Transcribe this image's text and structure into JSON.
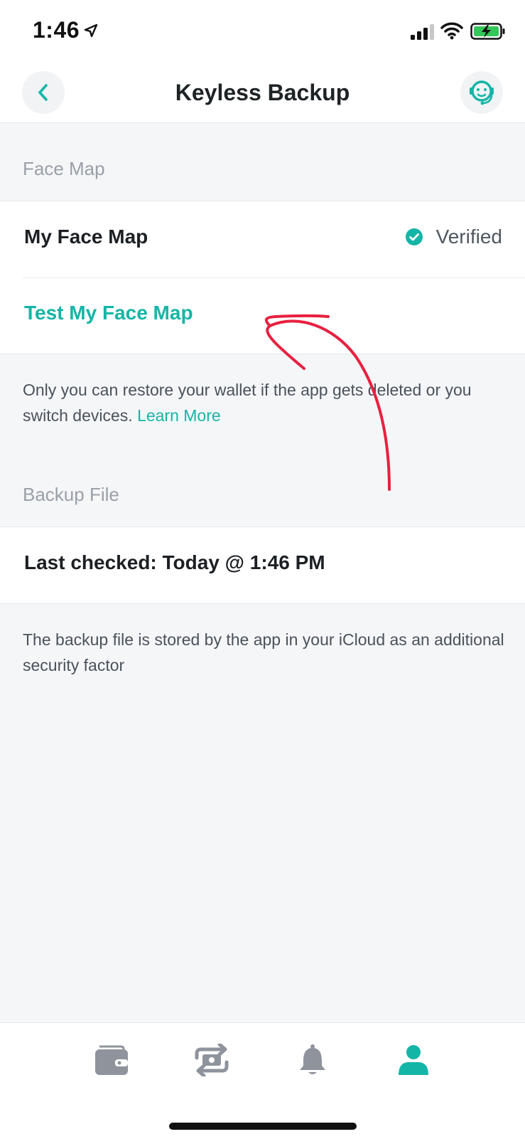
{
  "status_bar": {
    "time": "1:46"
  },
  "nav": {
    "title": "Keyless Backup"
  },
  "face_map_section": {
    "header": "Face Map",
    "my_face_map_label": "My Face Map",
    "status": "Verified",
    "test_link": "Test My Face Map",
    "description": "Only you can restore your wallet if the app gets deleted or you switch devices.",
    "learn_more": "Learn More"
  },
  "backup_section": {
    "header": "Backup File",
    "last_checked": "Last checked: Today @ 1:46 PM",
    "description": "The backup file is stored by the app in your iCloud as an additional security factor"
  },
  "tabs": [
    {
      "icon": "wallet-icon",
      "active": false
    },
    {
      "icon": "exchange-icon",
      "active": false
    },
    {
      "icon": "bell-icon",
      "active": false
    },
    {
      "icon": "profile-icon",
      "active": true
    }
  ],
  "colors": {
    "accent": "#14b5a6",
    "inactive_icon": "#8e939c",
    "background": "#f5f6f8",
    "annotation": "#e8203f"
  }
}
